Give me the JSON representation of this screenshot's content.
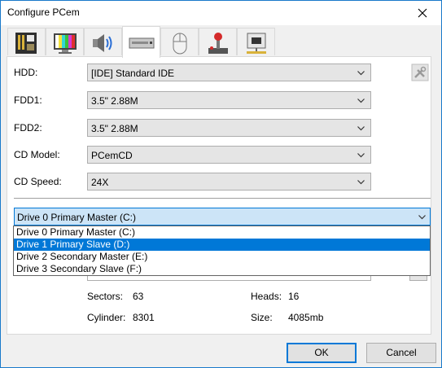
{
  "window": {
    "title": "Configure PCem"
  },
  "tabs": [
    {
      "icon": "motherboard-icon"
    },
    {
      "icon": "display-monitor-icon"
    },
    {
      "icon": "speaker-icon"
    },
    {
      "icon": "drive-icon"
    },
    {
      "icon": "mouse-icon"
    },
    {
      "icon": "joystick-icon"
    },
    {
      "icon": "network-icon"
    }
  ],
  "form": {
    "hdd_label": "HDD:",
    "hdd_value": "[IDE] Standard IDE",
    "fdd1_label": "FDD1:",
    "fdd1_value": "3.5\" 2.88M",
    "fdd2_label": "FDD2:",
    "fdd2_value": "3.5\" 2.88M",
    "cd_model_label": "CD Model:",
    "cd_model_value": "PCemCD",
    "cd_speed_label": "CD Speed:",
    "cd_speed_value": "24X"
  },
  "drive_select": {
    "value": "Drive 0 Primary Master (C:)",
    "options": [
      "Drive 0 Primary Master (C:)",
      "Drive 1 Primary Slave (D:)",
      "Drive 2 Secondary Master (E:)",
      "Drive 3 Secondary Slave (F:)"
    ],
    "highlighted": "Drive 1 Primary Slave (D:)"
  },
  "geometry_info": {
    "sectors_label": "Sectors:",
    "sectors_value": "63",
    "heads_label": "Heads:",
    "heads_value": "16",
    "cylinder_label": "Cylinder:",
    "cylinder_value": "8301",
    "size_label": "Size:",
    "size_value": "4085mb"
  },
  "buttons": {
    "ok": "OK",
    "cancel": "Cancel"
  },
  "colors": {
    "accent": "#0078d7",
    "window_border": "#1979ca",
    "dialog_bg": "#f0f0f0"
  }
}
